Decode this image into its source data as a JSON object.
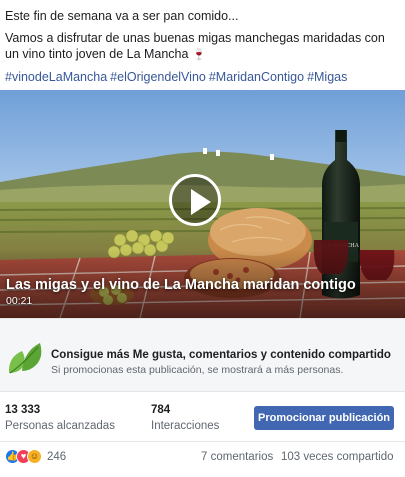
{
  "post": {
    "line1": "Este fin de semana va a ser pan comido...",
    "line2": "Vamos a disfrutar de unas buenas migas manchegas maridadas con un vino tinto joven de La Mancha",
    "wine_emoji": "🍷",
    "hashtags": [
      "#vinodeLaMancha",
      "#elOrigendelVino",
      "#MaridanContigo",
      "#Migas"
    ]
  },
  "video": {
    "title": "Las migas y el vino de La Mancha maridan contigo",
    "duration": "00:21",
    "play_icon": "play-icon"
  },
  "promo": {
    "icon": "leaf-icon",
    "title": "Consigue más Me gusta, comentarios y contenido compartido",
    "subtitle": "Si promocionas esta publicación, se mostrará a más personas."
  },
  "stats": {
    "reach_value": "13 333",
    "reach_label": "Personas alcanzadas",
    "interactions_value": "784",
    "interactions_label": "Interacciones",
    "promote_button": "Promocionar publicación"
  },
  "footer": {
    "reaction_count": "246",
    "comments": "7 comentarios",
    "shares": "103 veces compartido"
  },
  "colors": {
    "link": "#385898",
    "primary_button": "#4267b2",
    "like": "#1877f2",
    "love": "#f33e58",
    "haha": "#f7b125",
    "leaf": "#6bbf3a"
  }
}
